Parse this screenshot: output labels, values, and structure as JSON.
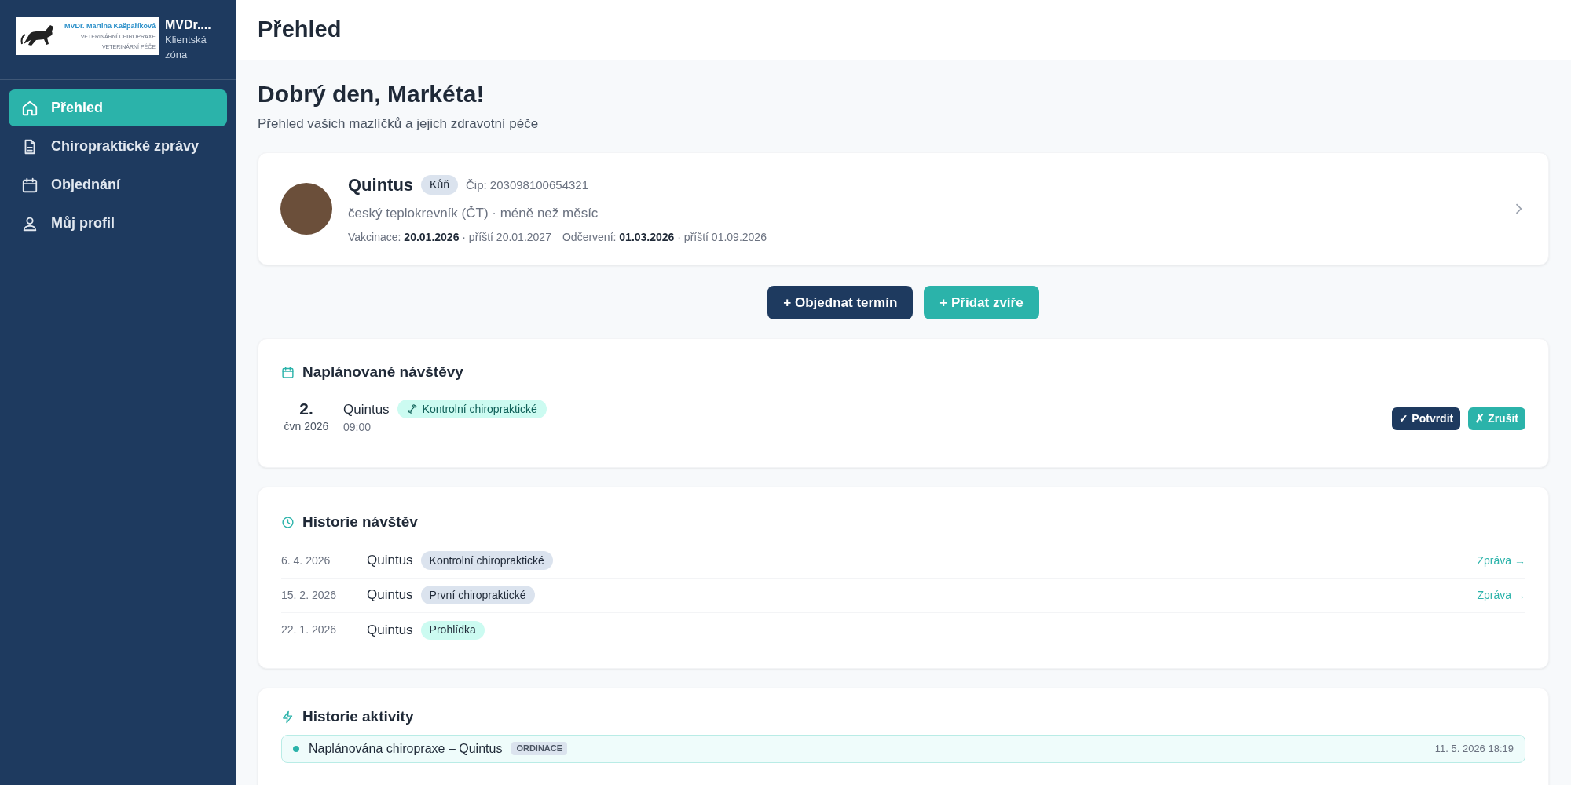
{
  "sidebar": {
    "logo_lines": [
      "MVDr. Martina Kašpaříková",
      "VETERINÁRNÍ CHIROPRAXE",
      "VETERINÁRNÍ PÉČE"
    ],
    "brand_title": "MVDr....",
    "brand_subtitle": "Klientská zóna",
    "items": [
      {
        "label": "Přehled",
        "selected": true
      },
      {
        "label": "Chiropraktické zprávy",
        "selected": false
      },
      {
        "label": "Objednání",
        "selected": false
      },
      {
        "label": "Můj profil",
        "selected": false
      }
    ]
  },
  "header": {
    "title": "Přehled"
  },
  "greeting": {
    "title": "Dobrý den, Markéta!",
    "subtitle": "Přehled vašich mazlíčků a jejich zdravotní péče"
  },
  "pets": [
    {
      "name": "Quintus",
      "species": "Kůň",
      "chip": "Čip: 203098100654321",
      "breed": "český teplokrevník (ČT) · méně než měsíc",
      "vaccination_label": "Vakcinace:",
      "vaccination_date": "20.01.2026",
      "vaccination_next": "· příští 20.01.2027",
      "deworming_label": "Odčervení:",
      "deworming_date": "01.03.2026",
      "deworming_next": "· příští 01.09.2026"
    }
  ],
  "actions": [
    {
      "label": "+ Objednat termín",
      "kind": "primary"
    },
    {
      "label": "+ Přidat zvíře",
      "kind": "secondary"
    }
  ],
  "scheduled": {
    "title": "Naplánované návštěvy",
    "visits": [
      {
        "day": "2.",
        "month": "čvn 2026",
        "pet": "Quintus",
        "type": "Kontrolní chiropraktické",
        "time": "09:00",
        "confirm": "✓ Potvrdit",
        "cancel": "✗ Zrušit"
      }
    ]
  },
  "history": {
    "title": "Historie návštěv",
    "visits": [
      {
        "date": "6. 4. 2026",
        "pet": "Quintus",
        "type": "Kontrolní chiropraktické",
        "color": "#dbe3ee",
        "link": "Zpráva →"
      },
      {
        "date": "15. 2. 2026",
        "pet": "Quintus",
        "type": "První chiropraktické",
        "color": "#dbe3ee",
        "link": "Zpráva →"
      },
      {
        "date": "22. 1. 2026",
        "pet": "Quintus",
        "type": "Prohlídka",
        "color": "#ccfbf1"
      }
    ]
  },
  "activity": {
    "title": "Historie aktivity",
    "items": [
      {
        "text": "Naplánována chiropraxe – Quintus",
        "badge": "ORDINACE",
        "time": "11. 5. 2026 18:19"
      }
    ]
  }
}
